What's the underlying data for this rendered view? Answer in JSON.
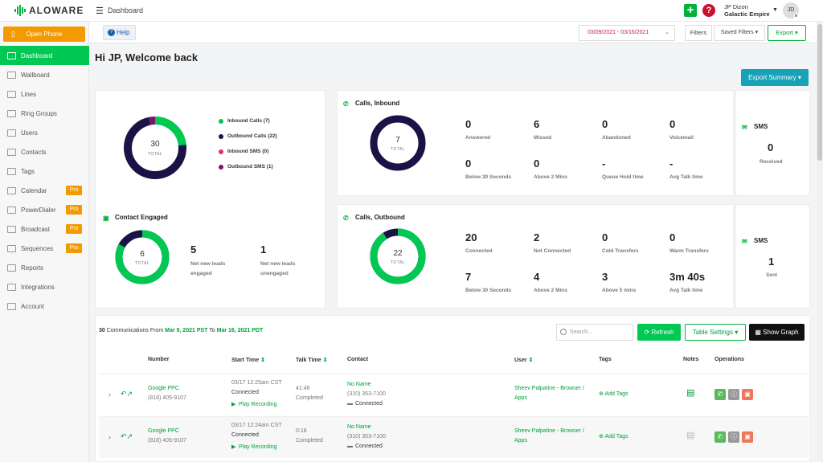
{
  "header": {
    "brand": "ALOWARE",
    "breadcrumb": "Dashboard",
    "user_name": "JP Dizon",
    "company": "Galactic Empire",
    "avatar_initials": "JD",
    "plus_icon": "plus-icon",
    "help_icon": "question-icon"
  },
  "sidebar": {
    "open_phone": "Open Phone",
    "items": [
      {
        "label": "Dashboard",
        "icon": "dashboard-icon",
        "active": true
      },
      {
        "label": "Wallboard",
        "icon": "monitor-icon"
      },
      {
        "label": "Lines",
        "icon": "lines-icon"
      },
      {
        "label": "Ring Groups",
        "icon": "ring-groups-icon"
      },
      {
        "label": "Users",
        "icon": "users-icon"
      },
      {
        "label": "Contacts",
        "icon": "contacts-icon"
      },
      {
        "label": "Tags",
        "icon": "tag-icon"
      },
      {
        "label": "Calendar",
        "icon": "calendar-icon",
        "badge": "Pro"
      },
      {
        "label": "PowerDialer",
        "icon": "power-dialer-icon",
        "badge": "Pro"
      },
      {
        "label": "Broadcast",
        "icon": "broadcast-icon",
        "badge": "Pro"
      },
      {
        "label": "Sequences",
        "icon": "sequences-icon",
        "badge": "Pro"
      },
      {
        "label": "Reports",
        "icon": "reports-icon"
      },
      {
        "label": "Integrations",
        "icon": "integrations-icon"
      },
      {
        "label": "Account",
        "icon": "account-icon"
      }
    ]
  },
  "toolbar": {
    "help": "Help",
    "date_range": "03/09/2021 - 03/16/2021",
    "filters": "Filters",
    "saved_filters": "Saved Filters",
    "export": "Export"
  },
  "welcome": "Hi JP, Welcome back",
  "export_summary": "Export Summary",
  "summary": {
    "total": "30",
    "total_label": "TOTAL",
    "legend": [
      {
        "label": "Inbound Calls (7)",
        "color": "#00c853",
        "value": 7
      },
      {
        "label": "Outbound Calls (22)",
        "color": "#1a1446",
        "value": 22
      },
      {
        "label": "Inbound SMS (0)",
        "color": "#e0307a",
        "value": 0
      },
      {
        "label": "Outbound SMS (1)",
        "color": "#7b1368",
        "value": 1
      }
    ]
  },
  "contact_engaged": {
    "title": "Contact Engaged",
    "total": "6",
    "total_label": "TOTAL",
    "engaged_fraction": 0.83,
    "stats": [
      {
        "value": "5",
        "label_line1": "Net new leads",
        "label_line2": "engaged"
      },
      {
        "value": "1",
        "label_line1": "Net new leads",
        "label_line2": "unengaged"
      }
    ]
  },
  "inbound": {
    "title": "Calls, Inbound",
    "total": "7",
    "total_label": "TOTAL",
    "stats": [
      {
        "value": "0",
        "label": "Answered"
      },
      {
        "value": "6",
        "label": "Missed"
      },
      {
        "value": "0",
        "label": "Abandoned"
      },
      {
        "value": "0",
        "label": "Voicemail"
      },
      {
        "value": "0",
        "label": "Below 30 Seconds"
      },
      {
        "value": "0",
        "label": "Above 2 Mins"
      },
      {
        "value": "-",
        "label": "Queue Hold time"
      },
      {
        "value": "-",
        "label": "Avg Talk time"
      }
    ]
  },
  "outbound": {
    "title": "Calls, Outbound",
    "total": "22",
    "total_label": "TOTAL",
    "connected_fraction": 0.91,
    "stats": [
      {
        "value": "20",
        "label": "Connected"
      },
      {
        "value": "2",
        "label": "Not Connected"
      },
      {
        "value": "0",
        "label": "Cold Transfers"
      },
      {
        "value": "0",
        "label": "Warm Transfers"
      },
      {
        "value": "7",
        "label": "Below 30 Seconds"
      },
      {
        "value": "4",
        "label": "Above 2 Mins"
      },
      {
        "value": "3",
        "label": "Above 5 mins"
      },
      {
        "value": "3m 40s",
        "label": "Avg Talk time"
      }
    ]
  },
  "sms_in": {
    "title": "SMS",
    "value": "0",
    "label": "Received"
  },
  "sms_out": {
    "title": "SMS",
    "value": "1",
    "label": "Sent"
  },
  "comms": {
    "count": "30",
    "text1": "Communications From",
    "from": "Mar 9, 2021 PST",
    "to_word": "To",
    "to": "Mar 16, 2021 PDT",
    "search_placeholder": "Search...",
    "refresh": "Refresh",
    "table_settings": "Table Settings",
    "show_graph": "Show Graph"
  },
  "table": {
    "headers": {
      "number": "Number",
      "start_time": "Start Time",
      "talk_time": "Talk Time",
      "contact": "Contact",
      "user": "User",
      "tags": "Tags",
      "notes": "Notes",
      "operations": "Operations"
    },
    "rows": [
      {
        "source": "Google PPC",
        "phone": "(818) 405-9107",
        "start": "03/17 12:25am CST",
        "status": "Connected",
        "play": "Play Recording",
        "talk": "41:46",
        "talk_status": "Completed",
        "contact": "No Name",
        "contact_phone": "(310) 353-7100",
        "contact_status": "Connected",
        "user1": "Sheev Palpatine - Browser /",
        "user2": "Apps",
        "add_tags": "Add Tags"
      },
      {
        "source": "Google PPC",
        "phone": "(818) 405-9107",
        "start": "03/17 12:24am CST",
        "status": "Connected",
        "play": "Play Recording",
        "talk": "0:18",
        "talk_status": "Completed",
        "contact": "No Name",
        "contact_phone": "(310) 353-7100",
        "contact_status": "Connected",
        "user1": "Sheev Palpatine - Browser /",
        "user2": "Apps",
        "add_tags": "Add Tags"
      }
    ]
  }
}
